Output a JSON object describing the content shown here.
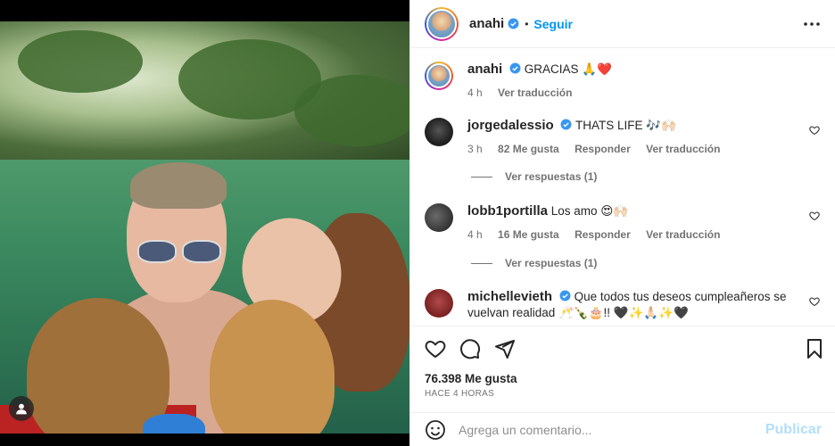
{
  "header": {
    "username": "anahi",
    "separator": "•",
    "follow_label": "Seguir"
  },
  "caption": {
    "username": "anahi",
    "text": "GRACIAS 🙏❤️",
    "time": "4 h",
    "translate": "Ver traducción"
  },
  "comments": [
    {
      "username": "jorgedalessio",
      "text": "THATS LIFE 🎶🙌🏻",
      "time": "3 h",
      "likes": "82 Me gusta",
      "reply": "Responder",
      "translate": "Ver traducción",
      "replies": "Ver respuestas (1)"
    },
    {
      "username": "lobb1portilla",
      "text": "Los amo 😍🙌🏻",
      "time": "4 h",
      "likes": "16 Me gusta",
      "reply": "Responder",
      "translate": "Ver traducción",
      "replies": "Ver respuestas (1)"
    },
    {
      "username": "michellevieth",
      "text": "Que todos tus deseos cumpleañeros se vuelvan realidad 🥂🍾🎂!! 🖤✨🙏🏻✨🖤"
    }
  ],
  "stats": {
    "likes": "76.398 Me gusta",
    "time_ago": "HACE 4 HORAS"
  },
  "add_comment": {
    "placeholder": "Agrega un comentario...",
    "post_label": "Publicar"
  },
  "colors": {
    "accent": "#0095f6",
    "post_disabled": "#b2dffc",
    "verified": "#3897f0",
    "muted": "#737373"
  }
}
